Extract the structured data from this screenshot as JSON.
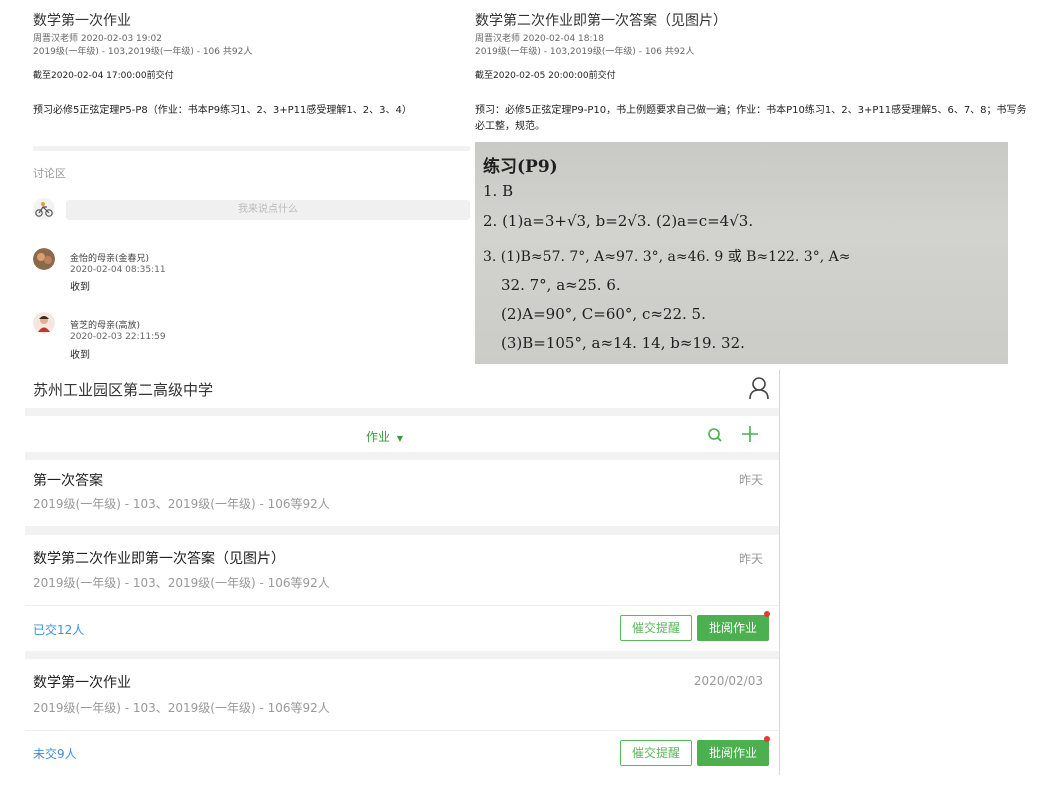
{
  "homework1": {
    "title": "数学第一次作业",
    "teacher_meta": "周晋汉老师  2020-02-03 19:02",
    "classes": "2019级(一年级) - 103,2019级(一年级) - 106 共92人",
    "deadline": "截至2020-02-04 17:00:00前交付",
    "description": "预习必修5正弦定理P5-P8（作业：书本P9练习1、2、3+P11感受理解1、2、3、4）"
  },
  "homework2": {
    "title": "数学第二次作业即第一次答案（见图片）",
    "teacher_meta": "周晋汉老师  2020-02-04 18:18",
    "classes": "2019级(一年级) - 103,2019级(一年级) - 106 共92人",
    "deadline": "截至2020-02-05 20:00:00前交付",
    "description": "预习：必修5正弦定理P9-P10，书上例题要求自己做一遍；作业：书本P10练习1、2、3+P11感受理解5、6、7、8；书写务必工整，规范。"
  },
  "discussion": {
    "label": "讨论区",
    "input_placeholder": "我来说点什么",
    "comments": [
      {
        "name": "金怡的母亲(金春兄)",
        "time": "2020-02-04 08:35:11",
        "text": "收到"
      },
      {
        "name": "管芝的母亲(高放)",
        "time": "2020-02-03 22:11:59",
        "text": "收到"
      }
    ]
  },
  "answer_image": {
    "lines": [
      "练习(P9)",
      "1. B",
      "2. (1)a=3+√3, b=2√3. (2)a=c=4√3.",
      "3. (1)B≈57. 7°, A≈97. 3°, a≈46. 9 或 B≈122. 3°, A≈",
      "32. 7°, a≈25. 6.",
      "(2)A=90°, C=60°, c≈22. 5.",
      "(3)B=105°, a≈14. 14, b≈19. 32."
    ]
  },
  "app": {
    "school_name": "苏州工业园区第二高级中学",
    "profile_icon": "person-outline-icon",
    "tab_label": "作业",
    "tab_caret": "▼",
    "search_icon": "search-icon",
    "add_icon": "plus-icon",
    "accent_color": "#4caf50"
  },
  "list": [
    {
      "title": "第一次答案",
      "sub": "2019级(一年级) - 103、2019级(一年级) - 106等92人",
      "date": "昨天"
    },
    {
      "title": "数学第二次作业即第一次答案（见图片）",
      "sub": "2019级(一年级) - 103、2019级(一年级) - 106等92人",
      "date": "昨天",
      "status": "已交12人",
      "remind_label": "催交提醒",
      "review_label": "批阅作业"
    },
    {
      "title": "数学第一次作业",
      "sub": "2019级(一年级) - 103、2019级(一年级) - 106等92人",
      "date": "2020/02/03",
      "status": "未交9人",
      "remind_label": "催交提醒",
      "review_label": "批阅作业"
    }
  ]
}
